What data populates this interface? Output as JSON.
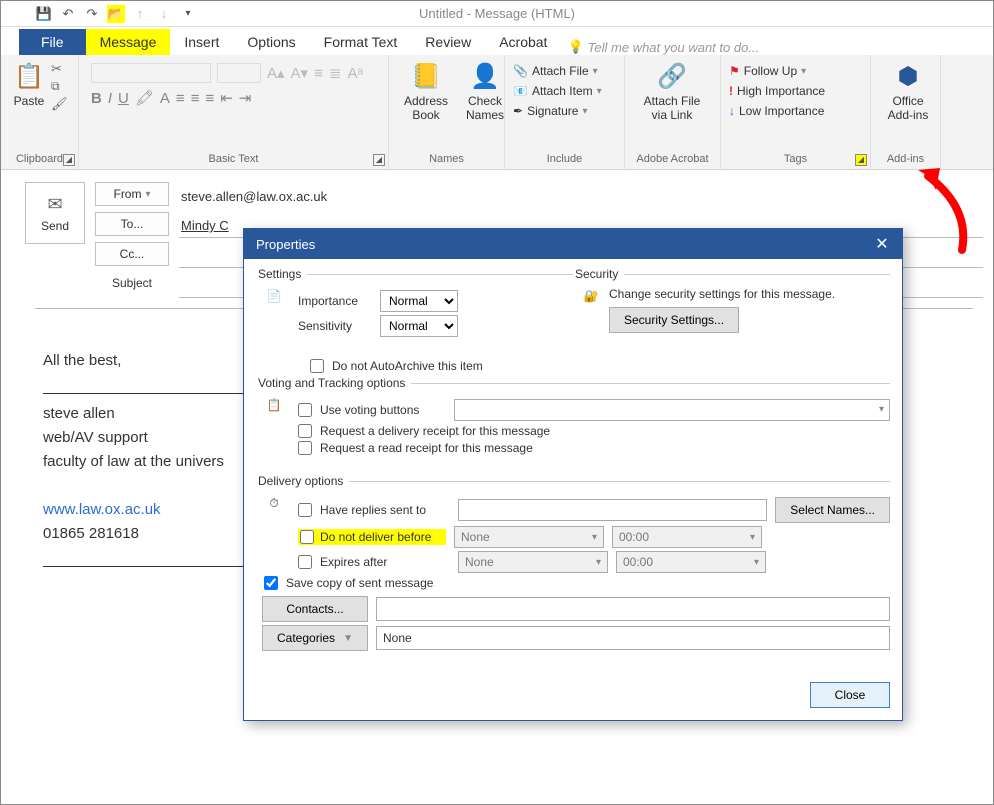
{
  "window": {
    "title": "Untitled - Message (HTML)"
  },
  "tabs": {
    "file": "File",
    "message": "Message",
    "insert": "Insert",
    "options": "Options",
    "format": "Format Text",
    "review": "Review",
    "acrobat": "Acrobat",
    "tellme": "Tell me what you want to do..."
  },
  "ribbon": {
    "clipboard": {
      "paste": "Paste",
      "label": "Clipboard"
    },
    "basictext": {
      "label": "Basic Text"
    },
    "names": {
      "address": "Address Book",
      "check": "Check Names",
      "label": "Names"
    },
    "include": {
      "attachfile": "Attach File",
      "attachitem": "Attach Item",
      "signature": "Signature",
      "label": "Include"
    },
    "acrobat": {
      "attachlink": "Attach File via Link",
      "label": "Adobe Acrobat"
    },
    "tags": {
      "followup": "Follow Up",
      "high": "High Importance",
      "low": "Low Importance",
      "label": "Tags"
    },
    "addins": {
      "office": "Office Add-ins",
      "label": "Add-ins"
    }
  },
  "compose": {
    "send": "Send",
    "from": "From",
    "to": "To...",
    "cc": "Cc...",
    "subject": "Subject",
    "from_value": "steve.allen@law.ox.ac.uk",
    "to_value": "Mindy C"
  },
  "body": {
    "greeting": "All the best,",
    "sig1": "steve allen",
    "sig2": "web/AV support",
    "sig3": "faculty of law at the univers",
    "link": "www.law.ox.ac.uk",
    "phone": "01865 281618"
  },
  "dialog": {
    "title": "Properties",
    "settings": {
      "legend": "Settings",
      "importance": "Importance",
      "importance_val": "Normal",
      "sensitivity": "Sensitivity",
      "sensitivity_val": "Normal",
      "autoarchive": "Do not AutoArchive this item"
    },
    "security": {
      "legend": "Security",
      "desc": "Change security settings for this message.",
      "button": "Security Settings..."
    },
    "voting": {
      "legend": "Voting and Tracking options",
      "use": "Use voting buttons",
      "delivery_receipt": "Request a delivery receipt for this message",
      "read_receipt": "Request a read receipt for this message"
    },
    "delivery": {
      "legend": "Delivery options",
      "replies": "Have replies sent to",
      "selectnames": "Select Names...",
      "notbefore": "Do not deliver before",
      "notbefore_date": "None",
      "notbefore_time": "00:00",
      "expires": "Expires after",
      "expires_date": "None",
      "expires_time": "00:00",
      "savecopy": "Save copy of sent message",
      "contacts": "Contacts...",
      "categories": "Categories",
      "categories_val": "None"
    },
    "close": "Close"
  }
}
